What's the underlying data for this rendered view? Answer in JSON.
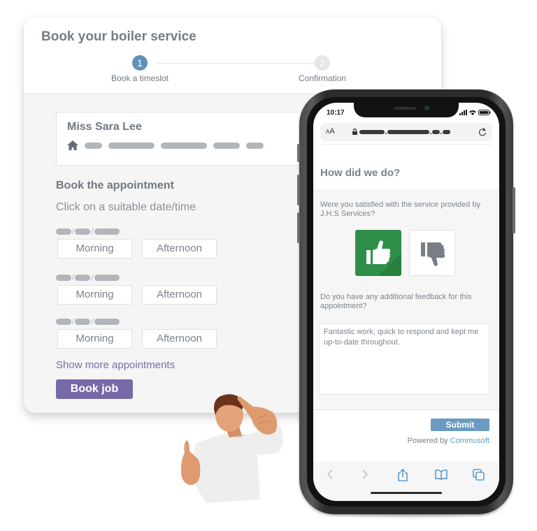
{
  "booking": {
    "title": "Book your boiler service",
    "steps": [
      {
        "number": "1",
        "label": "Book a timeslot",
        "active": true
      },
      {
        "number": "2",
        "label": "Confirmation",
        "active": false
      }
    ],
    "customer": {
      "name": "Miss Sara Lee",
      "address_icon": "home-icon",
      "address": "redacted"
    },
    "section_title": "Book the appointment",
    "section_subtitle": "Click on a suitable date/time",
    "dates": [
      {
        "date": "redacted",
        "slots": [
          "Morning",
          "Afternoon"
        ]
      },
      {
        "date": "redacted",
        "slots": [
          "Morning",
          "Afternoon"
        ]
      },
      {
        "date": "redacted",
        "slots": [
          "Morning",
          "Afternoon"
        ]
      }
    ],
    "show_more_label": "Show more appointments",
    "book_button_label": "Book job",
    "accent_color": "#7769a8"
  },
  "phone": {
    "status_time": "10:17",
    "url_bar": {
      "text_size_label": "AA",
      "url": "redacted"
    },
    "feedback_page": {
      "title": "How did we do?",
      "question1": "Were you satisfied with the service provided by J.H.S Services?",
      "thumbs_up_selected": true,
      "question2": "Do you have any additional feedback for this appointment?",
      "feedback_text": "Fantastic work, quick to respond and kept me up-to-date throughout.",
      "submit_label": "Submit",
      "powered_by_prefix": "Powered by",
      "powered_by_brand": "Commusoft",
      "positive_color": "#2f8f48",
      "submit_color": "#6a9bc0"
    },
    "toolbar": [
      "back-icon",
      "forward-icon",
      "share-icon",
      "bookmarks-icon",
      "tabs-icon"
    ]
  }
}
